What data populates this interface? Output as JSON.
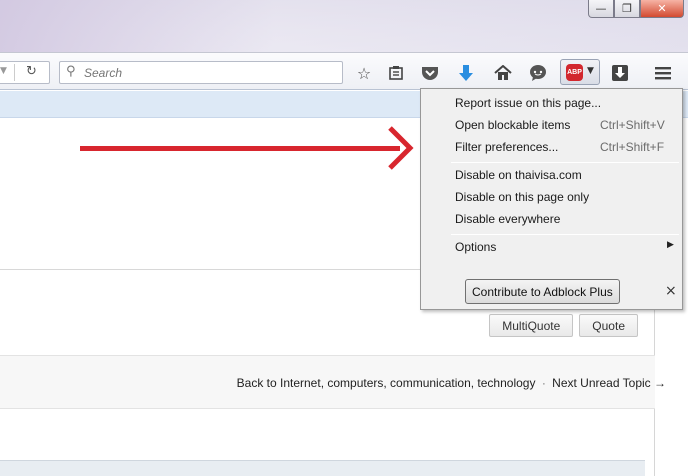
{
  "window": {
    "minimize": "—",
    "restore": "❐",
    "close": "✕"
  },
  "toolbar": {
    "search_placeholder": "Search",
    "icons": [
      "bookmark-star-icon",
      "reading-list-icon",
      "pocket-icon",
      "downloads-icon",
      "home-icon",
      "chat-icon",
      "adblock-plus-icon",
      "download-manager-icon",
      "hamburger-menu-icon"
    ]
  },
  "abp": {
    "badge": "ABP"
  },
  "abp_menu": {
    "items": [
      {
        "label": "Report issue on this page...",
        "shortcut": ""
      },
      {
        "label": "Open blockable items",
        "shortcut": "Ctrl+Shift+V"
      },
      {
        "label": "Filter preferences...",
        "shortcut": "Ctrl+Shift+F"
      },
      {
        "label": "Disable on thaivisa.com"
      },
      {
        "label": "Disable on this page only"
      },
      {
        "label": "Disable everywhere"
      },
      {
        "label": "Options"
      }
    ],
    "contribute_button": "Contribute to Adblock Plus",
    "close": "×"
  },
  "post": {
    "multiquote": "MultiQuote",
    "quote": "Quote"
  },
  "nav": {
    "back_link": "Back to Internet, computers, communication, technology",
    "separator": "·",
    "next_link": "Next Unread Topic →"
  },
  "colors": {
    "arrow": "#d8262e",
    "abp_red": "#d2272e",
    "download_blue": "#2a8ee0"
  }
}
